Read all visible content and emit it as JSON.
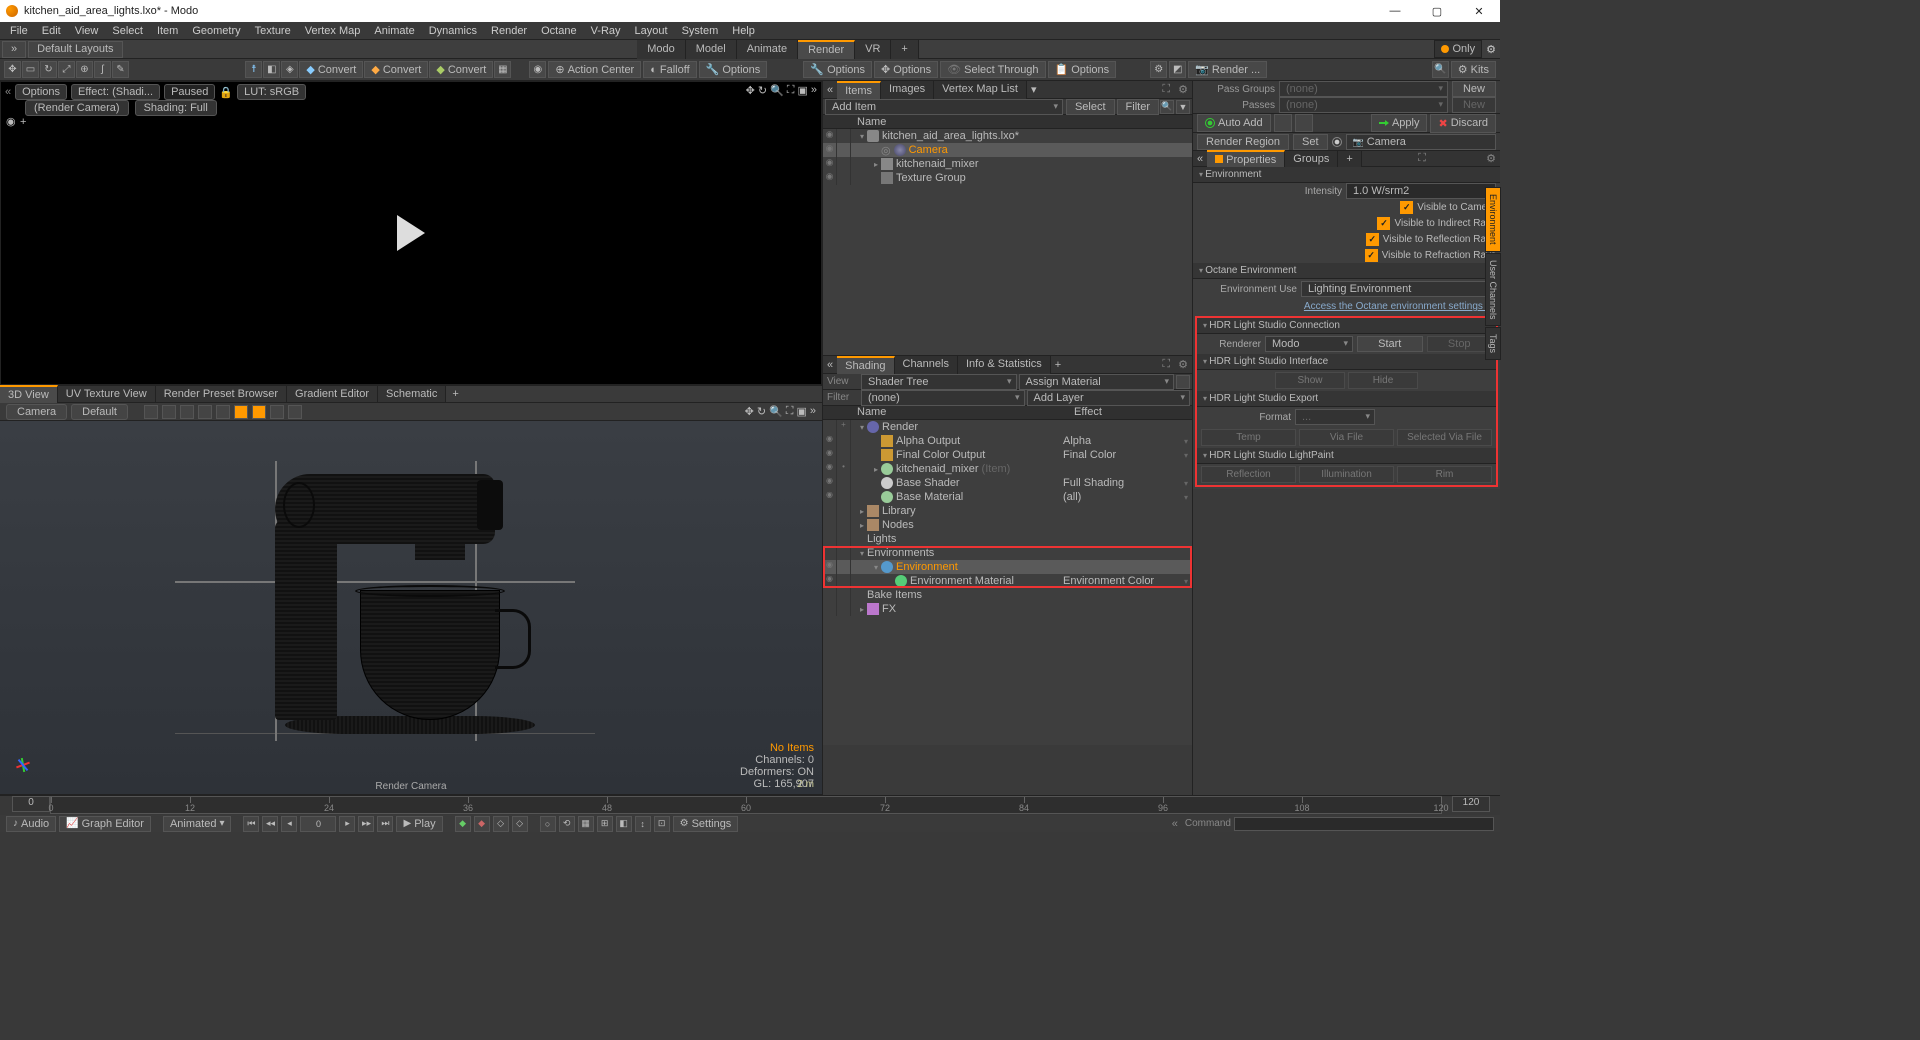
{
  "window": {
    "title": "kitchen_aid_area_lights.lxo* - Modo"
  },
  "menu": [
    "File",
    "Edit",
    "View",
    "Select",
    "Item",
    "Geometry",
    "Texture",
    "Vertex Map",
    "Animate",
    "Dynamics",
    "Render",
    "Octane",
    "V-Ray",
    "Layout",
    "System",
    "Help"
  ],
  "layoutbar": {
    "default": "Default Layouts",
    "tabs": [
      "Modo",
      "Model",
      "Animate",
      "Render",
      "VR"
    ],
    "active": "Render",
    "only": "Only"
  },
  "toolbar": {
    "convert": "Convert",
    "action_center": "Action Center",
    "falloff": "Falloff",
    "options": "Options",
    "select_through": "Select Through",
    "render": "Render ...",
    "kits": "Kits"
  },
  "render_preview": {
    "options": "Options",
    "effect": "Effect: (Shadi...",
    "paused": "Paused",
    "lut": "LUT: sRGB",
    "camera": "(Render Camera)",
    "shading": "Shading: Full"
  },
  "view_tabs": [
    "3D View",
    "UV Texture View",
    "Render Preset Browser",
    "Gradient Editor",
    "Schematic"
  ],
  "viewport": {
    "camera": "Camera",
    "style": "Default",
    "hud": {
      "noitems": "No Items",
      "channels": "Channels: 0",
      "deformers": "Deformers: ON",
      "gl": "GL: 165,907",
      "dist": "2 m"
    },
    "label": "Render Camera"
  },
  "items_panel": {
    "tabs": [
      "Items",
      "Images",
      "Vertex Map List"
    ],
    "add_item": "Add Item",
    "select": "Select",
    "filter": "Filter",
    "hdr_name": "Name",
    "tree": [
      {
        "d": 0,
        "i": "scene",
        "l": "kitchen_aid_area_lights.lxo*",
        "arr": "▾"
      },
      {
        "d": 1,
        "i": "cam",
        "l": "Camera",
        "sel": true,
        "r": "◎"
      },
      {
        "d": 1,
        "i": "mesh",
        "l": "kitchenaid_mixer",
        "arr": "▸"
      },
      {
        "d": 1,
        "i": "grp",
        "l": "Texture Group"
      }
    ]
  },
  "shading_panel": {
    "tabs": [
      "Shading",
      "Channels",
      "Info & Statistics"
    ],
    "view_lbl": "View",
    "view": "Shader Tree",
    "assign": "Assign Material",
    "filter_lbl": "Filter",
    "filter": "(none)",
    "addlayer": "Add Layer",
    "hdr_name": "Name",
    "hdr_effect": "Effect",
    "tree": [
      {
        "d": 0,
        "i": "render",
        "l": "Render",
        "arr": "▾",
        "plus": "+"
      },
      {
        "d": 1,
        "i": "out",
        "l": "Alpha Output",
        "fx": "Alpha",
        "fxdd": true,
        "eye": "◉"
      },
      {
        "d": 1,
        "i": "out",
        "l": "Final Color Output",
        "fx": "Final Color",
        "fxdd": true,
        "eye": "◉"
      },
      {
        "d": 1,
        "i": "mat",
        "l": "kitchenaid_mixer",
        "itm": "(Item)",
        "arr": "▸",
        "eye": "◉",
        "dot": "•"
      },
      {
        "d": 1,
        "i": "shade",
        "l": "Base Shader",
        "fx": "Full Shading",
        "fxdd": true,
        "eye": "◉"
      },
      {
        "d": 1,
        "i": "mat",
        "l": "Base Material",
        "fx": "(all)",
        "fxdd": true,
        "eye": "◉"
      },
      {
        "d": 0,
        "i": "lib",
        "l": "Library",
        "arr": "▸"
      },
      {
        "d": 0,
        "i": "lib",
        "l": "Nodes",
        "arr": "▸"
      },
      {
        "d": 0,
        "l": "Lights"
      },
      {
        "d": 0,
        "l": "Environments",
        "arr": "▾"
      },
      {
        "d": 1,
        "i": "env",
        "l": "Environment",
        "arr": "▾",
        "sel": true,
        "eye": "◉"
      },
      {
        "d": 2,
        "i": "envm",
        "l": "Environment Material",
        "fx": "Environment Color",
        "fxdd": true,
        "eye": "◉"
      },
      {
        "d": 0,
        "l": "Bake Items"
      },
      {
        "d": 0,
        "i": "fxi",
        "l": "FX",
        "arr": "▸"
      }
    ]
  },
  "right": {
    "pass_groups_lbl": "Pass Groups",
    "pass_groups": "(none)",
    "new": "New",
    "passes_lbl": "Passes",
    "passes": "(none)",
    "auto_add": "Auto Add",
    "apply": "Apply",
    "discard": "Discard",
    "render_region": "Render Region",
    "set": "Set",
    "camera": "Camera",
    "prop_tabs": [
      "Properties",
      "Groups"
    ],
    "sections": {
      "env": "Environment",
      "intensity_lbl": "Intensity",
      "intensity": "1.0 W/srm2",
      "vis_cam": "Visible to Camera",
      "vis_ind": "Visible to Indirect Rays",
      "vis_ref": "Visible to Reflection Rays",
      "vis_refr": "Visible to Refraction Rays",
      "oct_env": "Octane Environment",
      "env_use_lbl": "Environment Use",
      "env_use": "Lighting Environment",
      "oct_link": "Access the Octane environment settings ...",
      "hdr_conn": "HDR Light Studio Connection",
      "renderer_lbl": "Renderer",
      "renderer": "Modo",
      "start": "Start",
      "stop": "Stop",
      "hdr_iface": "HDR Light Studio Interface",
      "show": "Show",
      "hide": "Hide",
      "hdr_export": "HDR Light Studio Export",
      "format_lbl": "Format",
      "format": "...",
      "temp": "Temp",
      "viafile": "Via File",
      "selviafile": "Selected Via File",
      "hdr_lp": "HDR Light Studio LightPaint",
      "reflect": "Reflection",
      "illum": "Illumination",
      "rim": "Rim"
    },
    "sidetabs": [
      "Environment",
      "User Channels",
      "Tags"
    ]
  },
  "footer": {
    "timeline": {
      "ticks": [
        0,
        12,
        24,
        36,
        48,
        60,
        72,
        84,
        96,
        108,
        120
      ],
      "end0": "0",
      "end1": "120"
    },
    "audio": "Audio",
    "graph": "Graph Editor",
    "mode": "Animated",
    "play": "Play",
    "settings": "Settings",
    "command": "Command"
  }
}
